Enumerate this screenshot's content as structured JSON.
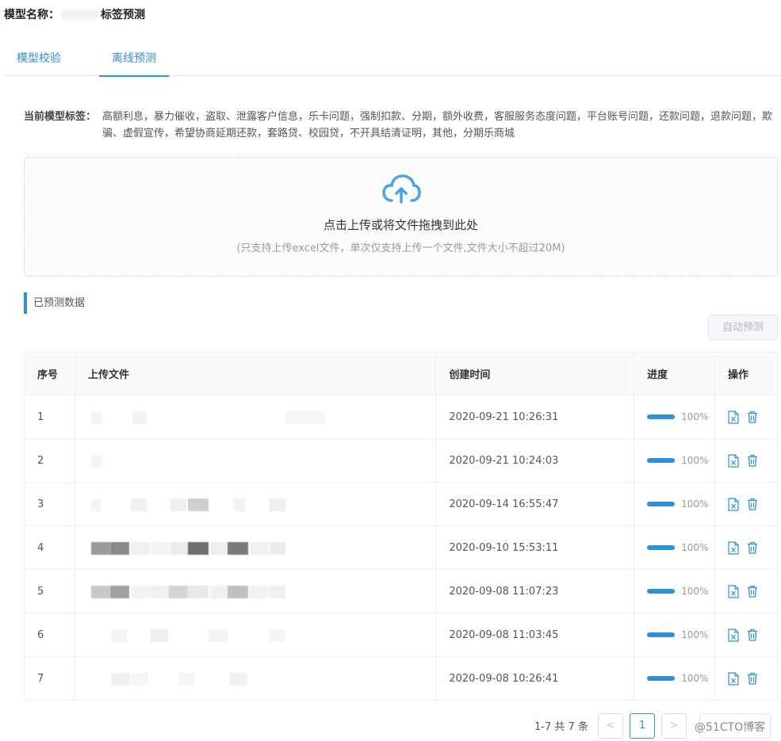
{
  "header": {
    "title_prefix": "模型名称：",
    "title_suffix": "标签预测"
  },
  "tabs": [
    {
      "label": "模型校验"
    },
    {
      "label": "离线预测"
    }
  ],
  "tags": {
    "label": "当前模型标签：",
    "value": "高额利息，暴力催收，盗取、泄露客户信息，乐卡问题，强制扣款、分期，额外收费，客服服务态度问题，平台账号问题，还款问题，退款问题，欺骗、虚假宣传，希望协商延期还款，套路贷、校园贷，不开具结清证明，其他，分期乐商城"
  },
  "upload": {
    "main": "点击上传或将文件拖拽到此处",
    "sub": "(只支持上传excel文件，单次仅支持上传一个文件,文件大小不超过20M)"
  },
  "section": {
    "title": "已预测数据"
  },
  "toolbar": {
    "auto_predict": "自动预测"
  },
  "table": {
    "headers": [
      "序号",
      "上传文件",
      "创建时间",
      "进度",
      "操作"
    ],
    "rows": [
      {
        "index": "1",
        "time": "2020-09-21 10:26:31",
        "progress": "100%"
      },
      {
        "index": "2",
        "time": "2020-09-21 10:24:03",
        "progress": "100%"
      },
      {
        "index": "3",
        "time": "2020-09-14 16:55:47",
        "progress": "100%"
      },
      {
        "index": "4",
        "time": "2020-09-10 15:53:11",
        "progress": "100%"
      },
      {
        "index": "5",
        "time": "2020-09-08 11:07:23",
        "progress": "100%"
      },
      {
        "index": "6",
        "time": "2020-09-08 11:03:45",
        "progress": "100%"
      },
      {
        "index": "7",
        "time": "2020-09-08 10:26:41",
        "progress": "100%"
      }
    ]
  },
  "pagination": {
    "total": "1-7 共 7 条",
    "prev": "<",
    "current": "1",
    "next": ">"
  },
  "watermark": "@51CTO博客",
  "colors": {
    "accent": "#2f8fd8"
  }
}
